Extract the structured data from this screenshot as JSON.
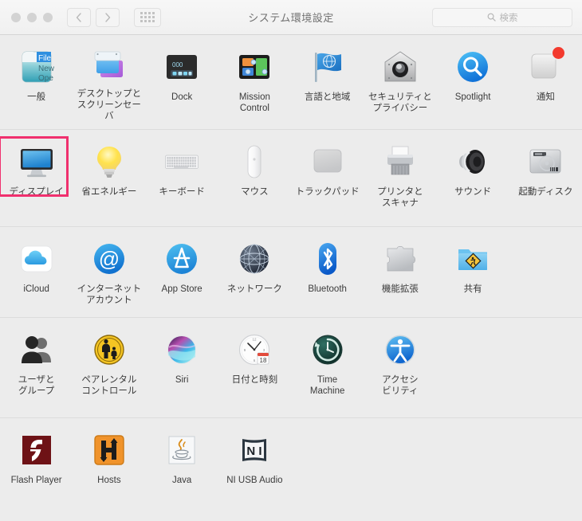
{
  "window": {
    "title": "システム環境設定",
    "traffic_lights": [
      "close",
      "minimize",
      "zoom"
    ],
    "nav": {
      "back_label": "戻る",
      "forward_label": "進む",
      "showall_label": "すべてを表示"
    },
    "search": {
      "placeholder": "検索",
      "value": "",
      "icon": "search-icon"
    }
  },
  "highlight": {
    "color": "#f0306e",
    "target": "ディスプレイ"
  },
  "rows": [
    {
      "id": "row-personal",
      "panes": [
        {
          "label": "一般",
          "icon": "general-icon"
        },
        {
          "label": "デスクトップと\nスクリーンセーバ",
          "icon": "desktop-screensaver-icon"
        },
        {
          "label": "Dock",
          "icon": "dock-icon"
        },
        {
          "label": "Mission\nControl",
          "icon": "mission-control-icon"
        },
        {
          "label": "言語と地域",
          "icon": "language-region-icon"
        },
        {
          "label": "セキュリティと\nプライバシー",
          "icon": "security-privacy-icon"
        },
        {
          "label": "Spotlight",
          "icon": "spotlight-icon"
        },
        {
          "label": "通知",
          "icon": "notifications-icon",
          "badge": true
        }
      ]
    },
    {
      "id": "row-hardware",
      "panes": [
        {
          "label": "ディスプレイ",
          "icon": "displays-icon",
          "highlighted": true
        },
        {
          "label": "省エネルギー",
          "icon": "energy-saver-icon"
        },
        {
          "label": "キーボード",
          "icon": "keyboard-icon"
        },
        {
          "label": "マウス",
          "icon": "mouse-icon"
        },
        {
          "label": "トラックパッド",
          "icon": "trackpad-icon"
        },
        {
          "label": "プリンタと\nスキャナ",
          "icon": "printers-scanners-icon"
        },
        {
          "label": "サウンド",
          "icon": "sound-icon"
        },
        {
          "label": "起動ディスク",
          "icon": "startup-disk-icon"
        }
      ]
    },
    {
      "id": "row-internet",
      "panes": [
        {
          "label": "iCloud",
          "icon": "icloud-icon"
        },
        {
          "label": "インターネット\nアカウント",
          "icon": "internet-accounts-icon"
        },
        {
          "label": "App Store",
          "icon": "app-store-icon"
        },
        {
          "label": "ネットワーク",
          "icon": "network-icon"
        },
        {
          "label": "Bluetooth",
          "icon": "bluetooth-icon"
        },
        {
          "label": "機能拡張",
          "icon": "extensions-icon"
        },
        {
          "label": "共有",
          "icon": "sharing-icon"
        },
        {
          "label": "",
          "icon": "",
          "empty": true
        }
      ]
    },
    {
      "id": "row-system",
      "panes": [
        {
          "label": "ユーザと\nグループ",
          "icon": "users-groups-icon"
        },
        {
          "label": "ペアレンタル\nコントロール",
          "icon": "parental-controls-icon"
        },
        {
          "label": "Siri",
          "icon": "siri-icon"
        },
        {
          "label": "日付と時刻",
          "icon": "date-time-icon",
          "calendar_day": "18"
        },
        {
          "label": "Time\nMachine",
          "icon": "time-machine-icon"
        },
        {
          "label": "アクセシ\nビリティ",
          "icon": "accessibility-icon"
        },
        {
          "label": "",
          "icon": "",
          "empty": true
        },
        {
          "label": "",
          "icon": "",
          "empty": true
        }
      ]
    },
    {
      "id": "row-other",
      "panes": [
        {
          "label": "Flash Player",
          "icon": "flash-player-icon"
        },
        {
          "label": "Hosts",
          "icon": "hosts-icon"
        },
        {
          "label": "Java",
          "icon": "java-icon"
        },
        {
          "label": "NI USB Audio",
          "icon": "ni-usb-audio-icon"
        },
        {
          "label": "",
          "icon": "",
          "empty": true
        },
        {
          "label": "",
          "icon": "",
          "empty": true
        },
        {
          "label": "",
          "icon": "",
          "empty": true
        },
        {
          "label": "",
          "icon": "",
          "empty": true
        }
      ]
    }
  ]
}
